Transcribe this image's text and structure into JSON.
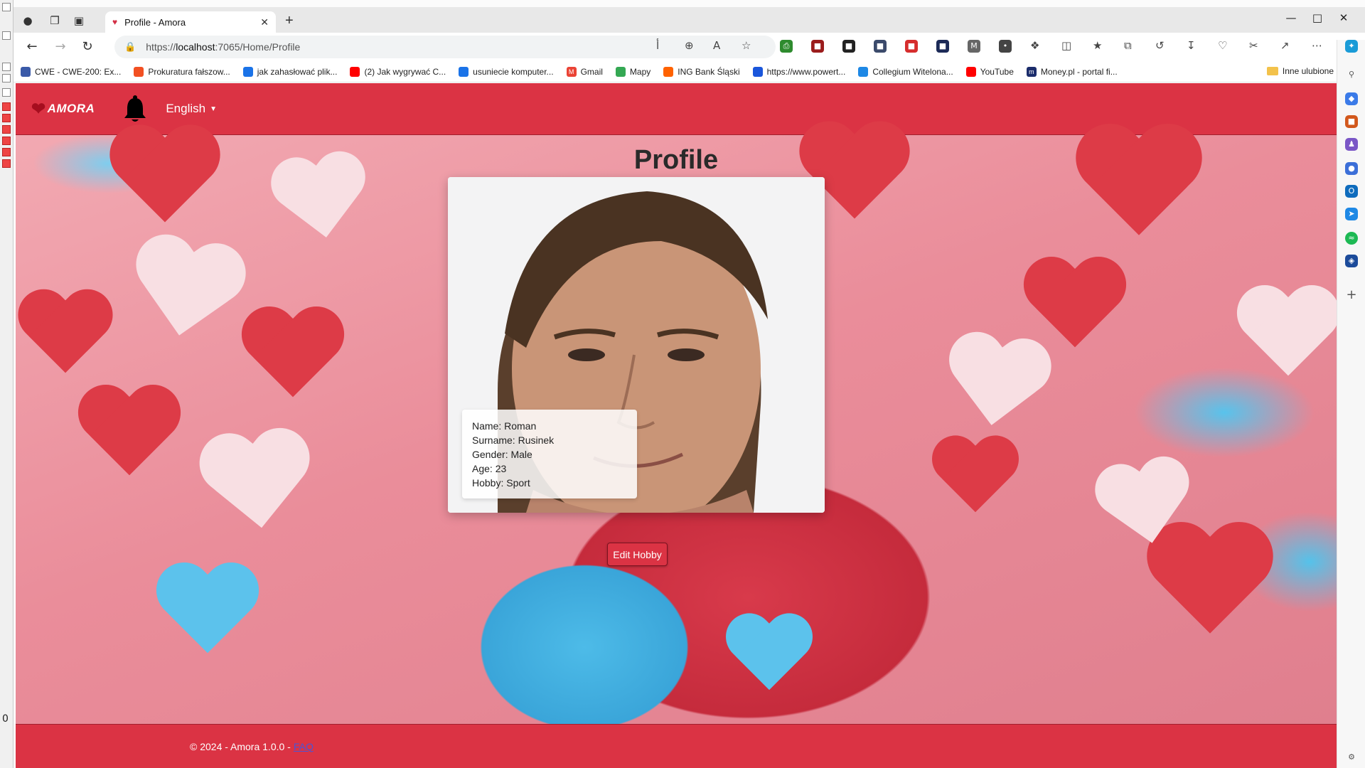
{
  "browser": {
    "tab_title": "Profile - Amora",
    "url_scheme": "https://",
    "url_host": "localhost",
    "url_rest": ":7065/Home/Profile"
  },
  "bookmarks": [
    {
      "label": "CWE - CWE-200: Ex...",
      "color": "#3a5aa8"
    },
    {
      "label": "Prokuratura fałszow...",
      "color": "#f25022"
    },
    {
      "label": "jak zahasłować plik...",
      "color": "#1a73e8"
    },
    {
      "label": "(2) Jak wygrywać C...",
      "color": "#ff0000"
    },
    {
      "label": "usuniecie komputer...",
      "color": "#1a73e8"
    },
    {
      "label": "Gmail",
      "color": "#ea4335"
    },
    {
      "label": "Mapy",
      "color": "#34a853"
    },
    {
      "label": "ING Bank Śląski",
      "color": "#ff6200"
    },
    {
      "label": "https://www.powert...",
      "color": "#1a56db"
    },
    {
      "label": "Collegium Witelona...",
      "color": "#1e88e5"
    },
    {
      "label": "YouTube",
      "color": "#ff0000"
    },
    {
      "label": "Money.pl - portal fi...",
      "color": "#1b2c6b"
    }
  ],
  "bookmarks_other": "Inne ulubione",
  "app": {
    "brand": "AMORA",
    "language": "English",
    "page_title": "Profile",
    "profile": {
      "name": "Name: Roman",
      "surname": "Surname: Rusinek",
      "gender": "Gender: Male",
      "age": "Age: 23",
      "hobby": "Hobby: Sport"
    },
    "edit_hobby_label": "Edit Hobby",
    "footer_text": "© 2024 - Amora 1.0.0 -",
    "footer_link": "FAQ"
  },
  "host": {
    "counter": "0"
  },
  "colors": {
    "brand_red": "#db3344",
    "link_blue": "#4a55d6"
  }
}
